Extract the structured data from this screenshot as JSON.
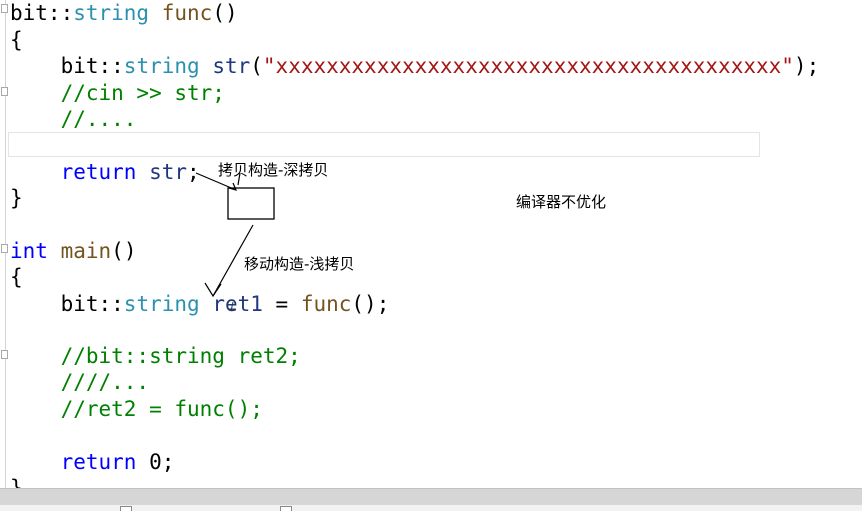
{
  "code": {
    "lines": [
      {
        "id": "func-signature",
        "segments": [
          {
            "t": "bit::",
            "c": "plain"
          },
          {
            "t": "string",
            "c": "type"
          },
          {
            "t": " ",
            "c": "plain"
          },
          {
            "t": "func",
            "c": "fn"
          },
          {
            "t": "()",
            "c": "plain"
          }
        ]
      },
      {
        "id": "func-open-brace",
        "segments": [
          {
            "t": "{",
            "c": "plain"
          }
        ]
      },
      {
        "id": "str-declaration",
        "segments": [
          {
            "t": "    bit::",
            "c": "plain"
          },
          {
            "t": "string",
            "c": "type"
          },
          {
            "t": " ",
            "c": "plain"
          },
          {
            "t": "str",
            "c": "ident"
          },
          {
            "t": "(",
            "c": "plain"
          },
          {
            "t": "\"xxxxxxxxxxxxxxxxxxxxxxxxxxxxxxxxxxxxxxxx\"",
            "c": "string"
          },
          {
            "t": ");",
            "c": "plain"
          }
        ]
      },
      {
        "id": "cin-comment",
        "segments": [
          {
            "t": "    //cin >> str;",
            "c": "comment"
          }
        ]
      },
      {
        "id": "dots-comment",
        "segments": [
          {
            "t": "    //....",
            "c": "comment"
          }
        ]
      },
      {
        "id": "empty-line-1",
        "segments": []
      },
      {
        "id": "return-str",
        "segments": [
          {
            "t": "    ",
            "c": "plain"
          },
          {
            "t": "return",
            "c": "keyword"
          },
          {
            "t": " ",
            "c": "plain"
          },
          {
            "t": "str",
            "c": "ident"
          },
          {
            "t": ";",
            "c": "plain"
          }
        ]
      },
      {
        "id": "func-close-brace",
        "segments": [
          {
            "t": "}",
            "c": "plain"
          }
        ]
      },
      {
        "id": "empty-line-2",
        "segments": []
      },
      {
        "id": "main-signature",
        "segments": [
          {
            "t": "int",
            "c": "keyword"
          },
          {
            "t": " ",
            "c": "plain"
          },
          {
            "t": "main",
            "c": "fn"
          },
          {
            "t": "()",
            "c": "plain"
          }
        ]
      },
      {
        "id": "main-open-brace",
        "segments": [
          {
            "t": "{",
            "c": "plain"
          }
        ]
      },
      {
        "id": "ret1-declaration",
        "segments": [
          {
            "t": "    bit::",
            "c": "plain"
          },
          {
            "t": "string",
            "c": "type"
          },
          {
            "t": " ",
            "c": "plain"
          },
          {
            "t": "ret1",
            "c": "ident"
          },
          {
            "t": " = ",
            "c": "plain"
          },
          {
            "t": "func",
            "c": "fn"
          },
          {
            "t": "();",
            "c": "plain"
          }
        ]
      },
      {
        "id": "empty-line-3",
        "segments": []
      },
      {
        "id": "ret2-decl-comment",
        "segments": [
          {
            "t": "    //bit::string ret2;",
            "c": "comment"
          }
        ]
      },
      {
        "id": "slashes-comment",
        "segments": [
          {
            "t": "    ////...",
            "c": "comment"
          }
        ]
      },
      {
        "id": "ret2-assign-comment",
        "segments": [
          {
            "t": "    //ret2 = func();",
            "c": "comment"
          }
        ]
      },
      {
        "id": "empty-line-4",
        "segments": []
      },
      {
        "id": "return-zero",
        "segments": [
          {
            "t": "    ",
            "c": "plain"
          },
          {
            "t": "return",
            "c": "keyword"
          },
          {
            "t": " 0;",
            "c": "plain"
          }
        ]
      },
      {
        "id": "main-close-brace",
        "segments": [
          {
            "t": "}",
            "c": "plain"
          }
        ]
      }
    ]
  },
  "annotations": {
    "copy_construct": "拷贝构造-深拷贝",
    "move_construct": "移动构造-浅拷贝",
    "no_optimization": "编译器不优化"
  },
  "colors": {
    "keyword": "#0000ff",
    "type": "#2b91af",
    "function": "#74531f",
    "identifier": "#1f377f",
    "string": "#a31515",
    "comment": "#008000",
    "status_bar": "#d6d6d6"
  }
}
